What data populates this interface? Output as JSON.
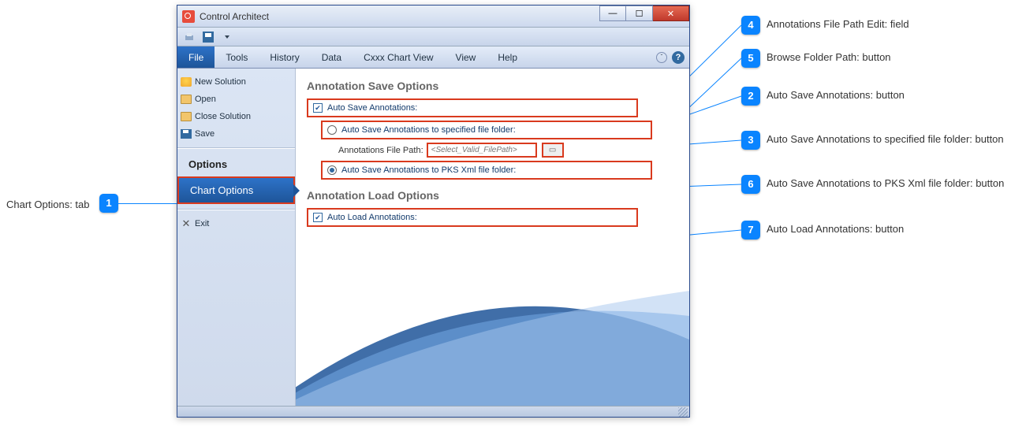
{
  "window": {
    "title": "Control Architect"
  },
  "menubar": {
    "file": "File",
    "tools": "Tools",
    "history": "History",
    "data": "Data",
    "cxxx": "Cxxx Chart View",
    "view": "View",
    "help": "Help"
  },
  "sidebar": {
    "new_solution": "New Solution",
    "open": "Open",
    "close_solution": "Close Solution",
    "save": "Save",
    "options_heading": "Options",
    "chart_options": "Chart Options",
    "exit": "Exit"
  },
  "panel": {
    "save_title": "Annotation Save Options",
    "auto_save": "Auto Save Annotations:",
    "auto_save_to_folder": "Auto Save Annotations to specified file folder:",
    "file_path_label": "Annotations File Path:",
    "file_path_placeholder": "<Select_Valid_FilePath>",
    "auto_save_pks": "Auto Save Annotations to PKS Xml file folder:",
    "load_title": "Annotation Load Options",
    "auto_load": "Auto Load Annotations:"
  },
  "callouts": {
    "c1": {
      "num": "1",
      "text": "Chart Options: tab"
    },
    "c2": {
      "num": "2",
      "text": "Auto Save Annotations: button"
    },
    "c3": {
      "num": "3",
      "text": "Auto Save Annotations to specified file folder: button"
    },
    "c4": {
      "num": "4",
      "text": "Annotations File Path Edit: field"
    },
    "c5": {
      "num": "5",
      "text": "Browse Folder Path: button"
    },
    "c6": {
      "num": "6",
      "text": "Auto Save Annotations to PKS Xml file folder: button"
    },
    "c7": {
      "num": "7",
      "text": "Auto Load Annotations: button"
    }
  }
}
